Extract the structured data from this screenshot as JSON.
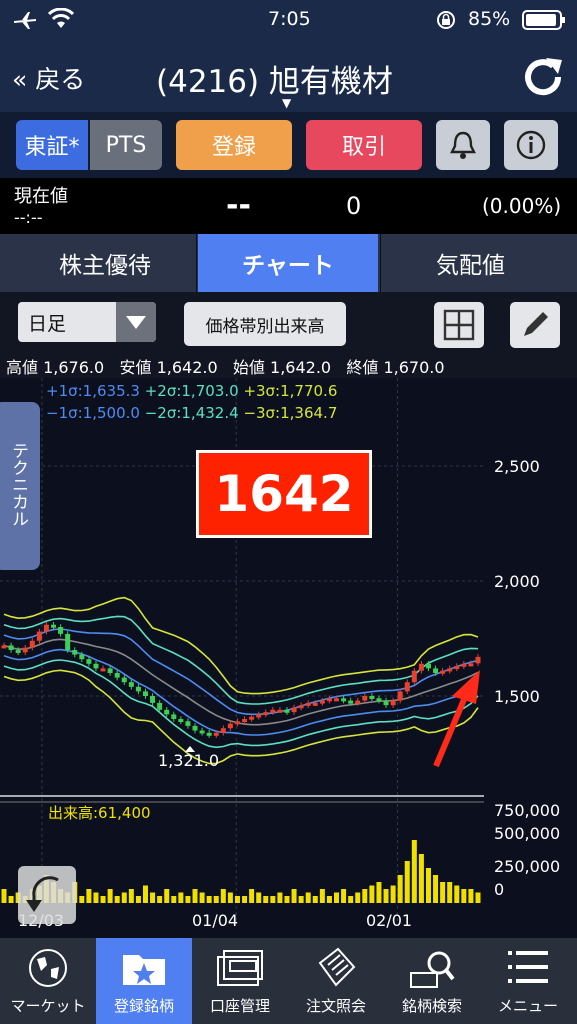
{
  "status_bar": {
    "time": "7:05",
    "battery": "85%"
  },
  "header": {
    "back_label": "« 戻る",
    "title": "(4216) 旭有機材"
  },
  "actions": {
    "market_tse": "東証*",
    "market_pts": "PTS",
    "register": "登録",
    "trade": "取引",
    "colors": {
      "register": "#f0a04a",
      "trade": "#e8485e",
      "tse": "#3d6be0"
    }
  },
  "price": {
    "label": "現在値",
    "time": "--:--",
    "value": "--",
    "change": "0",
    "change_pct": "(0.00%)"
  },
  "tabs": [
    {
      "label": "株主優待",
      "active": false
    },
    {
      "label": "チャート",
      "active": true
    },
    {
      "label": "気配値",
      "active": false
    }
  ],
  "controls": {
    "period": "日足",
    "volume_profile_button": "価格帯別出来高"
  },
  "ohlc": {
    "high_label": "高値",
    "high": "1,676.0",
    "low_label": "安値",
    "low": "1,642.0",
    "open_label": "始値",
    "open": "1,642.0",
    "close_label": "終値",
    "close": "1,670.0"
  },
  "bands": {
    "p1": "+1σ:1,635.3",
    "p2": "+2σ:1,703.0",
    "p3": "+3σ:1,770.6",
    "m1": "−1σ:1,500.0",
    "m2": "−2σ:1,432.4",
    "m3": "−3σ:1,364.7"
  },
  "technical_tab": "テクニカル",
  "callout": "1642",
  "chart_data": {
    "type": "candlestick",
    "price_axis_ticks": [
      "2,500",
      "2,000",
      "1,500"
    ],
    "price_axis_values": [
      2500,
      2000,
      1500
    ],
    "volume_axis_ticks": [
      "750,000",
      "500,000",
      "250,000",
      "0"
    ],
    "x_ticks": [
      "12/03",
      "01/04",
      "02/01"
    ],
    "annotation_low": "1,321.0",
    "volume_label": "出来高:61,400",
    "closes": [
      1720,
      1700,
      1690,
      1710,
      1740,
      1780,
      1810,
      1800,
      1770,
      1700,
      1680,
      1660,
      1640,
      1620,
      1620,
      1600,
      1580,
      1560,
      1540,
      1520,
      1500,
      1470,
      1440,
      1420,
      1400,
      1390,
      1370,
      1350,
      1340,
      1330,
      1340,
      1360,
      1380,
      1390,
      1400,
      1410,
      1420,
      1430,
      1440,
      1440,
      1430,
      1450,
      1460,
      1470,
      1470,
      1480,
      1490,
      1490,
      1480,
      1470,
      1480,
      1500,
      1490,
      1480,
      1460,
      1480,
      1520,
      1560,
      1610,
      1640,
      1620,
      1600,
      1610,
      1620,
      1630,
      1640,
      1642,
      1670
    ],
    "volumes": [
      0.2,
      0.1,
      0.15,
      0.1,
      0.2,
      0.25,
      0.4,
      0.3,
      0.2,
      0.15,
      0.3,
      0.1,
      0.2,
      0.15,
      0.1,
      0.2,
      0.1,
      0.15,
      0.2,
      0.1,
      0.25,
      0.15,
      0.1,
      0.2,
      0.1,
      0.15,
      0.1,
      0.2,
      0.15,
      0.1,
      0.1,
      0.2,
      0.15,
      0.1,
      0.1,
      0.2,
      0.15,
      0.1,
      0.1,
      0.15,
      0.1,
      0.2,
      0.1,
      0.15,
      0.1,
      0.2,
      0.1,
      0.15,
      0.2,
      0.1,
      0.15,
      0.2,
      0.25,
      0.3,
      0.2,
      0.25,
      0.4,
      0.6,
      0.9,
      0.7,
      0.5,
      0.4,
      0.3,
      0.3,
      0.25,
      0.2,
      0.2,
      0.15
    ],
    "colors": {
      "up": "#e8412e",
      "down": "#3fcf55",
      "mid": "#8a8a8a",
      "s1": "#4d8cf0",
      "s2": "#5be0c0",
      "s3": "#d6e53a",
      "volume": "#f0e000"
    }
  },
  "nav": [
    "マーケット",
    "登録銘柄",
    "口座管理",
    "注文照会",
    "銘柄検索",
    "メニュー"
  ]
}
